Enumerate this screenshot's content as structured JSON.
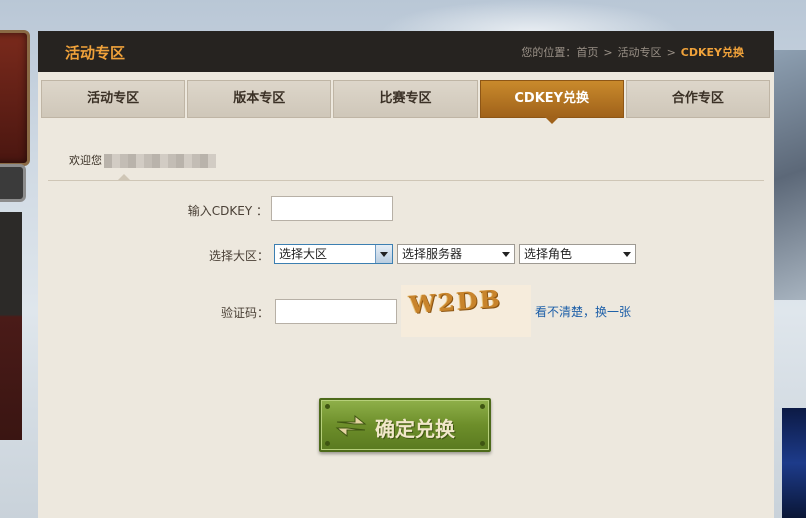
{
  "header": {
    "title": "活动专区",
    "breadcrumb": {
      "prefix": "您的位置：",
      "items": [
        "首页",
        "活动专区",
        "CDKEY兑换"
      ],
      "separator": ">"
    }
  },
  "tabs": [
    {
      "label": "活动专区",
      "active": false
    },
    {
      "label": "版本专区",
      "active": false
    },
    {
      "label": "比赛专区",
      "active": false
    },
    {
      "label": "CDKEY兑换",
      "active": true
    },
    {
      "label": "合作专区",
      "active": false
    }
  ],
  "welcome": {
    "prefix": "欢迎您"
  },
  "form": {
    "cdkey_label": "输入CDKEY ：",
    "cdkey_value": "",
    "region_label": "选择大区：",
    "region_select": "选择大区",
    "server_select": "选择服务器",
    "role_select": "选择角色",
    "captcha_label": "验证码：",
    "captcha_value": "",
    "captcha_text": "W2DB",
    "refresh_link": "看不清楚，换一张",
    "submit_label": "确定兑换"
  },
  "colors": {
    "accent": "#f0a23a",
    "active_tab": "#b87722",
    "submit_green": "#6d8e2a",
    "link_blue": "#1d5fa8"
  }
}
